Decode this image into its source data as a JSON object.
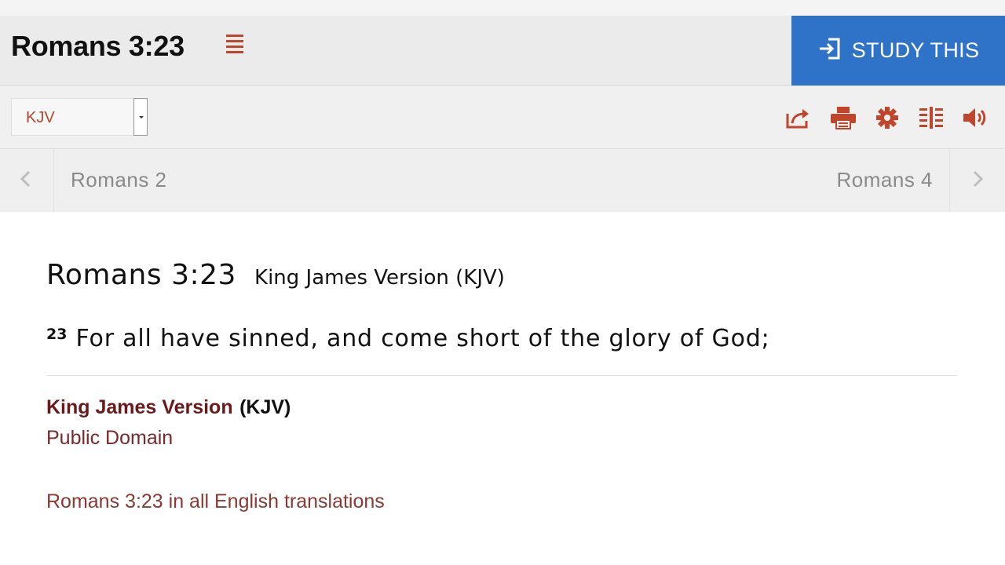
{
  "header": {
    "title": "Romans 3:23",
    "study_button_label": "STUDY THIS"
  },
  "toolbar": {
    "version_selected": "KJV",
    "icons": [
      "share-icon",
      "print-icon",
      "gear-icon",
      "parallel-icon",
      "audio-icon"
    ]
  },
  "chapter_nav": {
    "prev_label": "Romans 2",
    "next_label": "Romans 4"
  },
  "passage": {
    "reference": "Romans 3:23",
    "version_name": "King James Version (KJV)",
    "verse_number": "23",
    "verse_text": "For all have sinned, and come short of the glory of God;"
  },
  "copyright": {
    "version_full": "King James Version",
    "version_abbr": "(KJV)",
    "license": "Public Domain"
  },
  "all_translations_link": "Romans 3:23 in all English translations",
  "colors": {
    "accent_red": "#c0452a",
    "study_blue": "#2f73c9",
    "link_maroon": "#6b1a1a"
  }
}
